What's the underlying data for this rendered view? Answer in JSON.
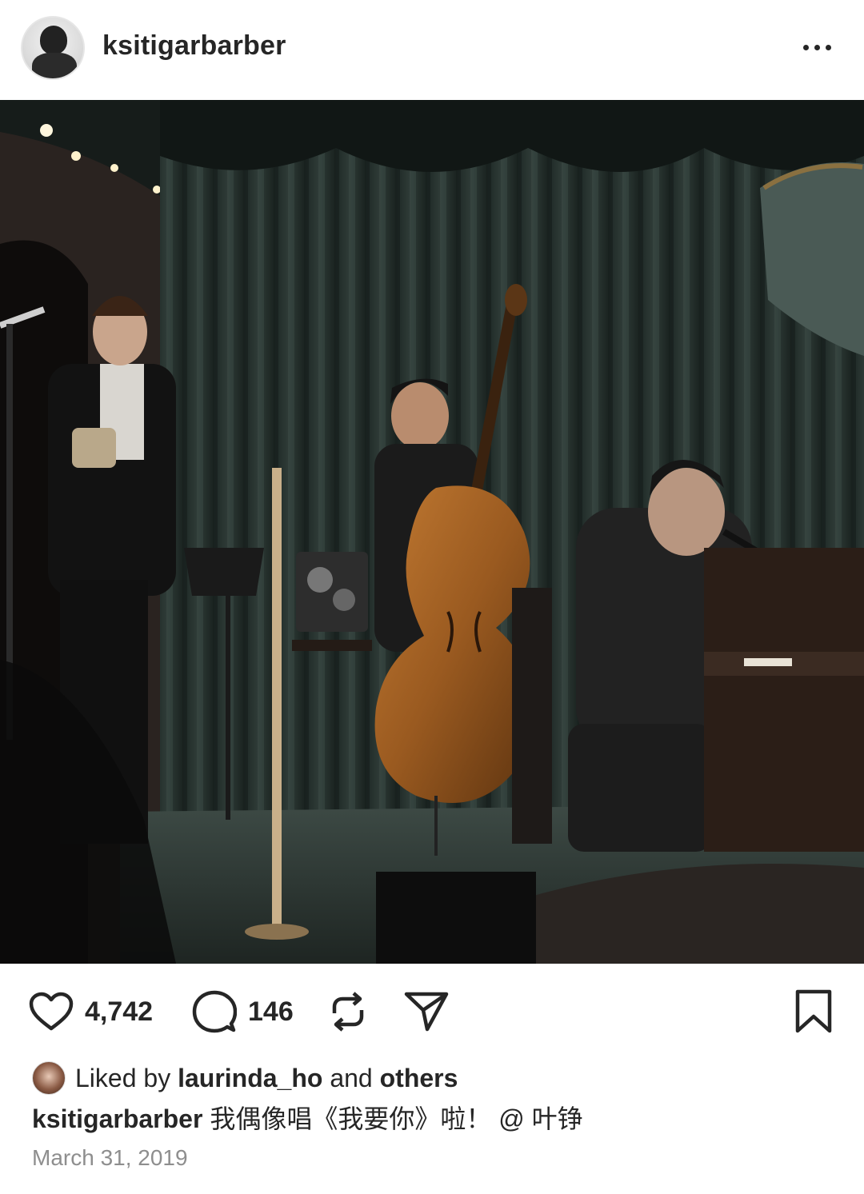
{
  "post": {
    "username": "ksitigarbarber",
    "more_icon": "more-horizontal-icon",
    "photo_alt": "",
    "mute_icon": "speaker-muted-icon"
  },
  "actions": {
    "like_count": "4,742",
    "comment_count": "146",
    "icons": [
      "heart-icon",
      "comment-icon",
      "repost-icon",
      "share-icon",
      "bookmark-icon"
    ]
  },
  "likes": {
    "prefix": "Liked by",
    "user": "laurinda_ho",
    "conjunction": "and",
    "others": "others"
  },
  "caption": {
    "username": "ksitigarbarber",
    "text": "我偶像唱《我要你》啦！ @ 叶铮"
  },
  "date": "March 31, 2019",
  "colors": {
    "text": "#262626",
    "secondary": "#8e8e8e",
    "background": "#ffffff"
  }
}
